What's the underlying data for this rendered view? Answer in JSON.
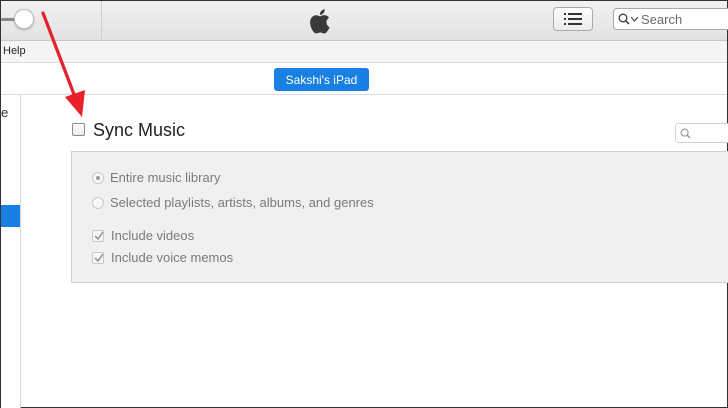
{
  "search": {
    "placeholder": "Search"
  },
  "menu": {
    "help": "Help"
  },
  "device": {
    "name": "Sakshi's iPad"
  },
  "sidebar": {
    "visible_glyph": "e"
  },
  "sync": {
    "title": "Sync Music",
    "checked": false,
    "options": {
      "entire_library": "Entire music library",
      "selected_items": "Selected playlists, artists, albums, and genres",
      "include_videos": "Include videos",
      "include_voice_memos": "Include voice memos"
    }
  },
  "colors": {
    "accent": "#1a7fe3",
    "annotation_arrow": "#e8202a"
  },
  "icons": [
    "apple-icon",
    "list-icon",
    "search-icon",
    "chevron-down-icon",
    "checkmark-icon"
  ]
}
